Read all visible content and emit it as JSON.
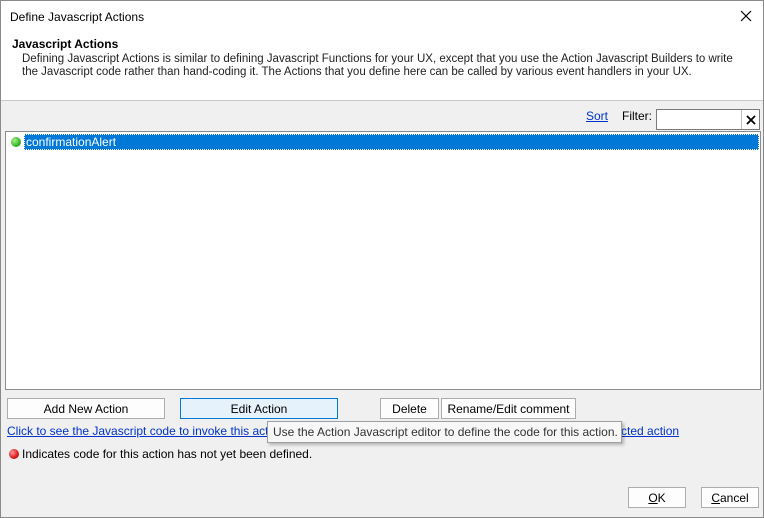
{
  "window": {
    "title": "Define Javascript Actions"
  },
  "header": {
    "title": "Javascript Actions",
    "description": "Defining Javascript Actions is similar to defining Javascript Functions for your UX, except that you use the Action Javascript Builders to write the Javascript code rather than hand-coding it. The Actions that you define here can be called by various event handlers in your UX."
  },
  "toolbar": {
    "sort_label": "Sort",
    "filter_label": "Filter:",
    "filter_value": ""
  },
  "list": {
    "items": [
      {
        "label": "confirmationAlert",
        "status": "defined",
        "selected": true
      }
    ]
  },
  "buttons": {
    "add": "Add New Action",
    "edit": "Edit Action",
    "delete": "Delete",
    "rename": "Rename/Edit comment",
    "ok_prefix": "",
    "ok_mnemonic": "O",
    "ok_suffix": "K",
    "cancel_prefix": "",
    "cancel_mnemonic": "C",
    "cancel_suffix": "ancel"
  },
  "links": {
    "view_code": "Click to see the Javascript code to invoke this action",
    "view_code_tail": "cted action"
  },
  "tooltip": {
    "text": "Use the Action Javascript editor to define the code for this action."
  },
  "legend": {
    "text": "Indicates code for this action has not yet been defined."
  },
  "colors": {
    "defined_dot": "#3dbb2f",
    "undefined_dot": "#e02020",
    "selection": "#0078d7",
    "link": "#0033cc"
  },
  "icons": {
    "close": "close-icon",
    "clear": "clear-x-icon"
  }
}
